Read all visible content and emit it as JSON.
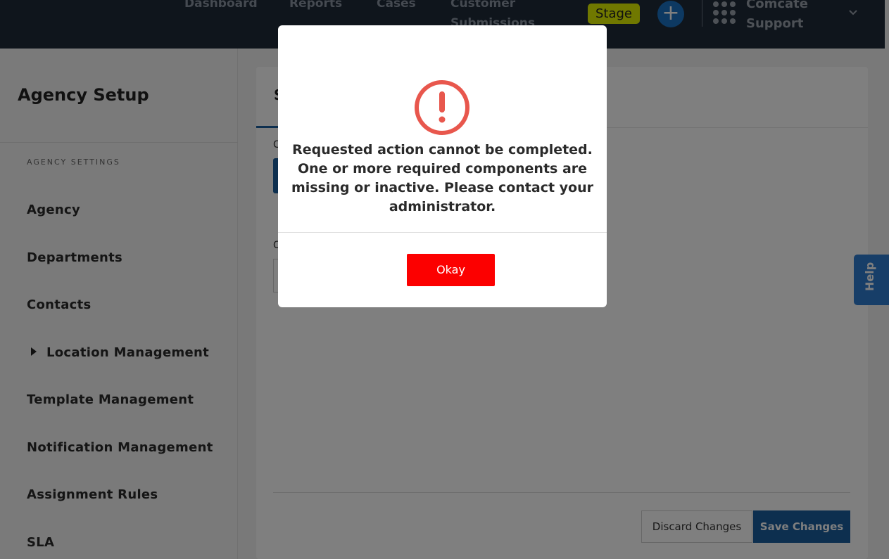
{
  "topbar": {
    "nav": [
      "Dashboard",
      "Reports",
      "Cases",
      "Customer Submissions"
    ],
    "stage_label": "Stage",
    "add_symbol": "+",
    "org_name_line1": "Comcate",
    "org_name_line2": "Support"
  },
  "sidebar": {
    "title": "Agency Setup",
    "section_label": "AGENCY SETTINGS",
    "items": [
      {
        "label": "Agency"
      },
      {
        "label": "Departments"
      },
      {
        "label": "Contacts"
      },
      {
        "label": "Location Management"
      },
      {
        "label": "Template Management"
      },
      {
        "label": "Notification Management"
      },
      {
        "label": "Assignment Rules"
      },
      {
        "label": "SLA"
      }
    ]
  },
  "main": {
    "tab_letter": "S",
    "field_label_1": "C",
    "field_label_2": "C",
    "discard_label": "Discard Changes",
    "save_label": "Save Changes"
  },
  "help": {
    "label": "Help"
  },
  "modal": {
    "icon": "alert-circle-icon",
    "message": "Requested action cannot be completed. One or more required components are missing or inactive. Please contact your administrator.",
    "okay_label": "Okay"
  },
  "colors": {
    "topbar_bg": "#1f2a38",
    "stage_badge": "#e1f000",
    "primary_blue": "#1a5f9e",
    "alert_red": "#e8574d",
    "okay_button": "#fc0000",
    "help_tab": "#2f7dd0"
  }
}
